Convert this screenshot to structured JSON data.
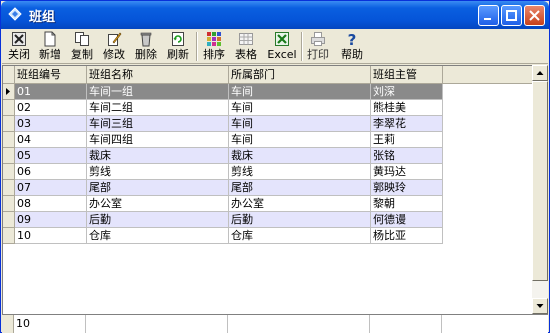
{
  "window": {
    "title": "班组"
  },
  "toolbar": {
    "items": [
      {
        "label": "关闭",
        "icon": "close-icon"
      },
      {
        "label": "新增",
        "icon": "new-icon"
      },
      {
        "label": "复制",
        "icon": "copy-icon"
      },
      {
        "label": "修改",
        "icon": "edit-icon"
      },
      {
        "label": "删除",
        "icon": "delete-icon"
      },
      {
        "label": "刷新",
        "icon": "refresh-icon"
      },
      {
        "label": "排序",
        "icon": "sort-icon"
      },
      {
        "label": "表格",
        "icon": "table-icon"
      },
      {
        "label": "Excel",
        "icon": "excel-icon"
      },
      {
        "label": "打印",
        "icon": "print-icon"
      },
      {
        "label": "帮助",
        "icon": "help-icon"
      }
    ]
  },
  "grid": {
    "columns": [
      "班组编号",
      "班组名称",
      "所属部门",
      "班组主管"
    ],
    "rows": [
      [
        "01",
        "车间一组",
        "车间",
        "刘深"
      ],
      [
        "02",
        "车间二组",
        "车间",
        "熊桂美"
      ],
      [
        "03",
        "车间三组",
        "车间",
        "李翠花"
      ],
      [
        "04",
        "车间四组",
        "车间",
        "王莉"
      ],
      [
        "05",
        "裁床",
        "裁床",
        "张铭"
      ],
      [
        "06",
        "剪线",
        "剪线",
        "黄玛达"
      ],
      [
        "07",
        "尾部",
        "尾部",
        "郭映玲"
      ],
      [
        "08",
        "办公室",
        "办公室",
        "黎朝"
      ],
      [
        "09",
        "后勤",
        "后勤",
        "何德谩"
      ],
      [
        "10",
        "仓库",
        "仓库",
        "杨比亚"
      ]
    ],
    "selected_row": 0
  },
  "footer": {
    "count": "10"
  },
  "colors": {
    "title_bar": "#0554d8",
    "alt_row": "#e4e4fc",
    "selected_row": "#8a8a8a"
  }
}
